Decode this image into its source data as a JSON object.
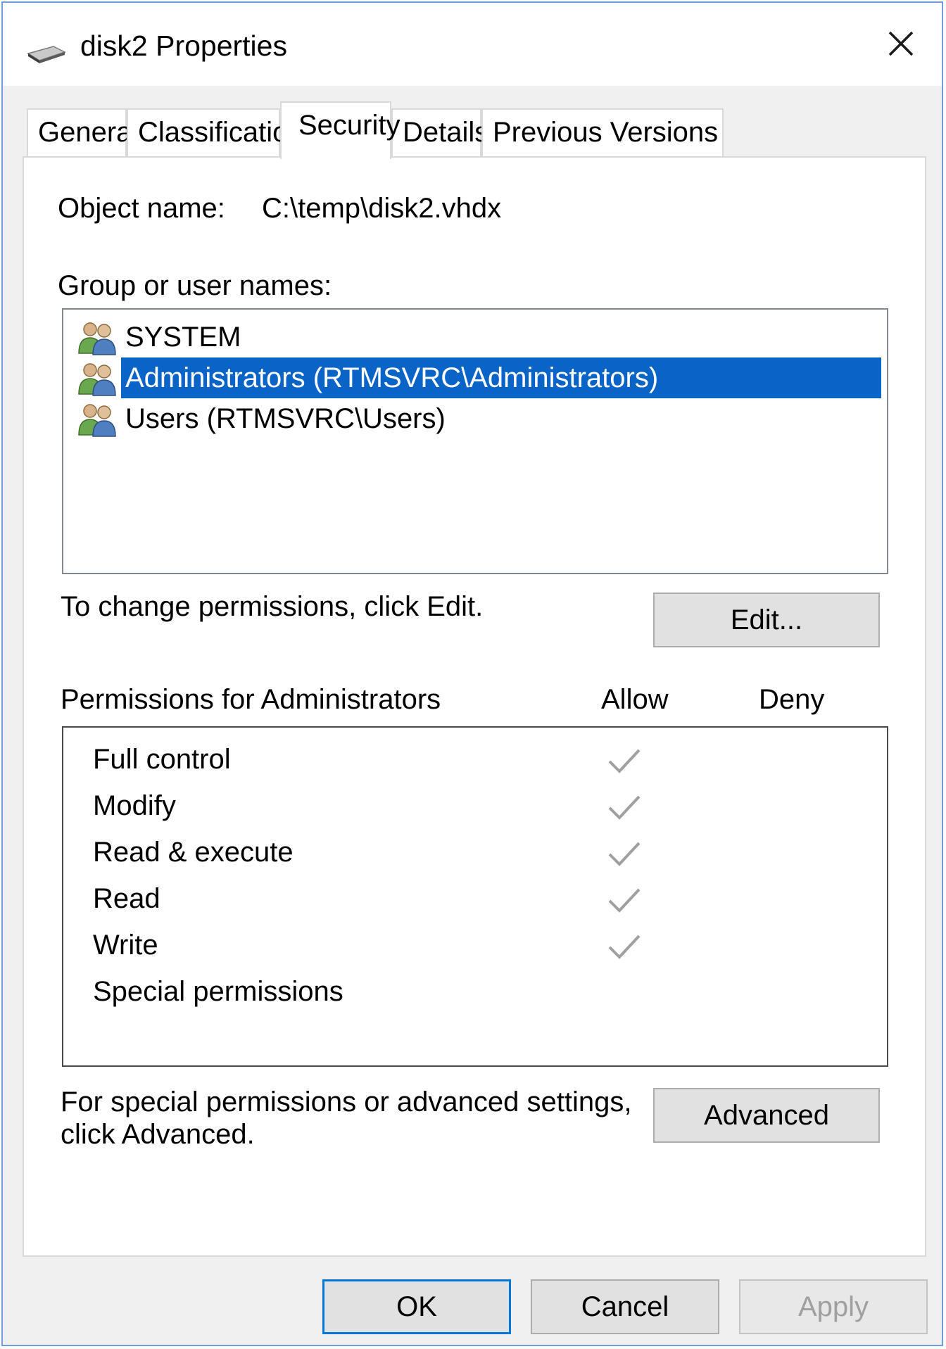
{
  "window": {
    "title": "disk2 Properties",
    "close_icon": "close-icon",
    "title_icon": "drive-icon"
  },
  "tabs": [
    {
      "label": "General",
      "active": false
    },
    {
      "label": "Classification",
      "active": false
    },
    {
      "label": "Security",
      "active": true
    },
    {
      "label": "Details",
      "active": false
    },
    {
      "label": "Previous Versions",
      "active": false
    }
  ],
  "security": {
    "object_name_label": "Object name:",
    "object_name_value": "C:\\temp\\disk2.vhdx",
    "group_label": "Group or user names:",
    "users": [
      {
        "name": "SYSTEM",
        "selected": false,
        "icon": "user-group-icon"
      },
      {
        "name": "Administrators (RTMSVRC\\Administrators)",
        "selected": true,
        "icon": "user-group-icon"
      },
      {
        "name": "Users (RTMSVRC\\Users)",
        "selected": false,
        "icon": "user-group-icon"
      }
    ],
    "change_hint": "To change permissions, click Edit.",
    "edit_button": "Edit...",
    "permissions_label": "Permissions for Administrators",
    "allow_header": "Allow",
    "deny_header": "Deny",
    "permissions": [
      {
        "name": "Full control",
        "allow": true,
        "deny": false
      },
      {
        "name": "Modify",
        "allow": true,
        "deny": false
      },
      {
        "name": "Read & execute",
        "allow": true,
        "deny": false
      },
      {
        "name": "Read",
        "allow": true,
        "deny": false
      },
      {
        "name": "Write",
        "allow": true,
        "deny": false
      },
      {
        "name": "Special permissions",
        "allow": false,
        "deny": false
      }
    ],
    "advanced_hint_line1": "For special permissions or advanced settings,",
    "advanced_hint_line2": "click Advanced.",
    "advanced_button": "Advanced"
  },
  "footer": {
    "ok": "OK",
    "cancel": "Cancel",
    "apply": "Apply"
  },
  "colors": {
    "selection": "#0a64c8",
    "check_gray": "#a0a0a0",
    "window_border": "#6f9fd8"
  }
}
